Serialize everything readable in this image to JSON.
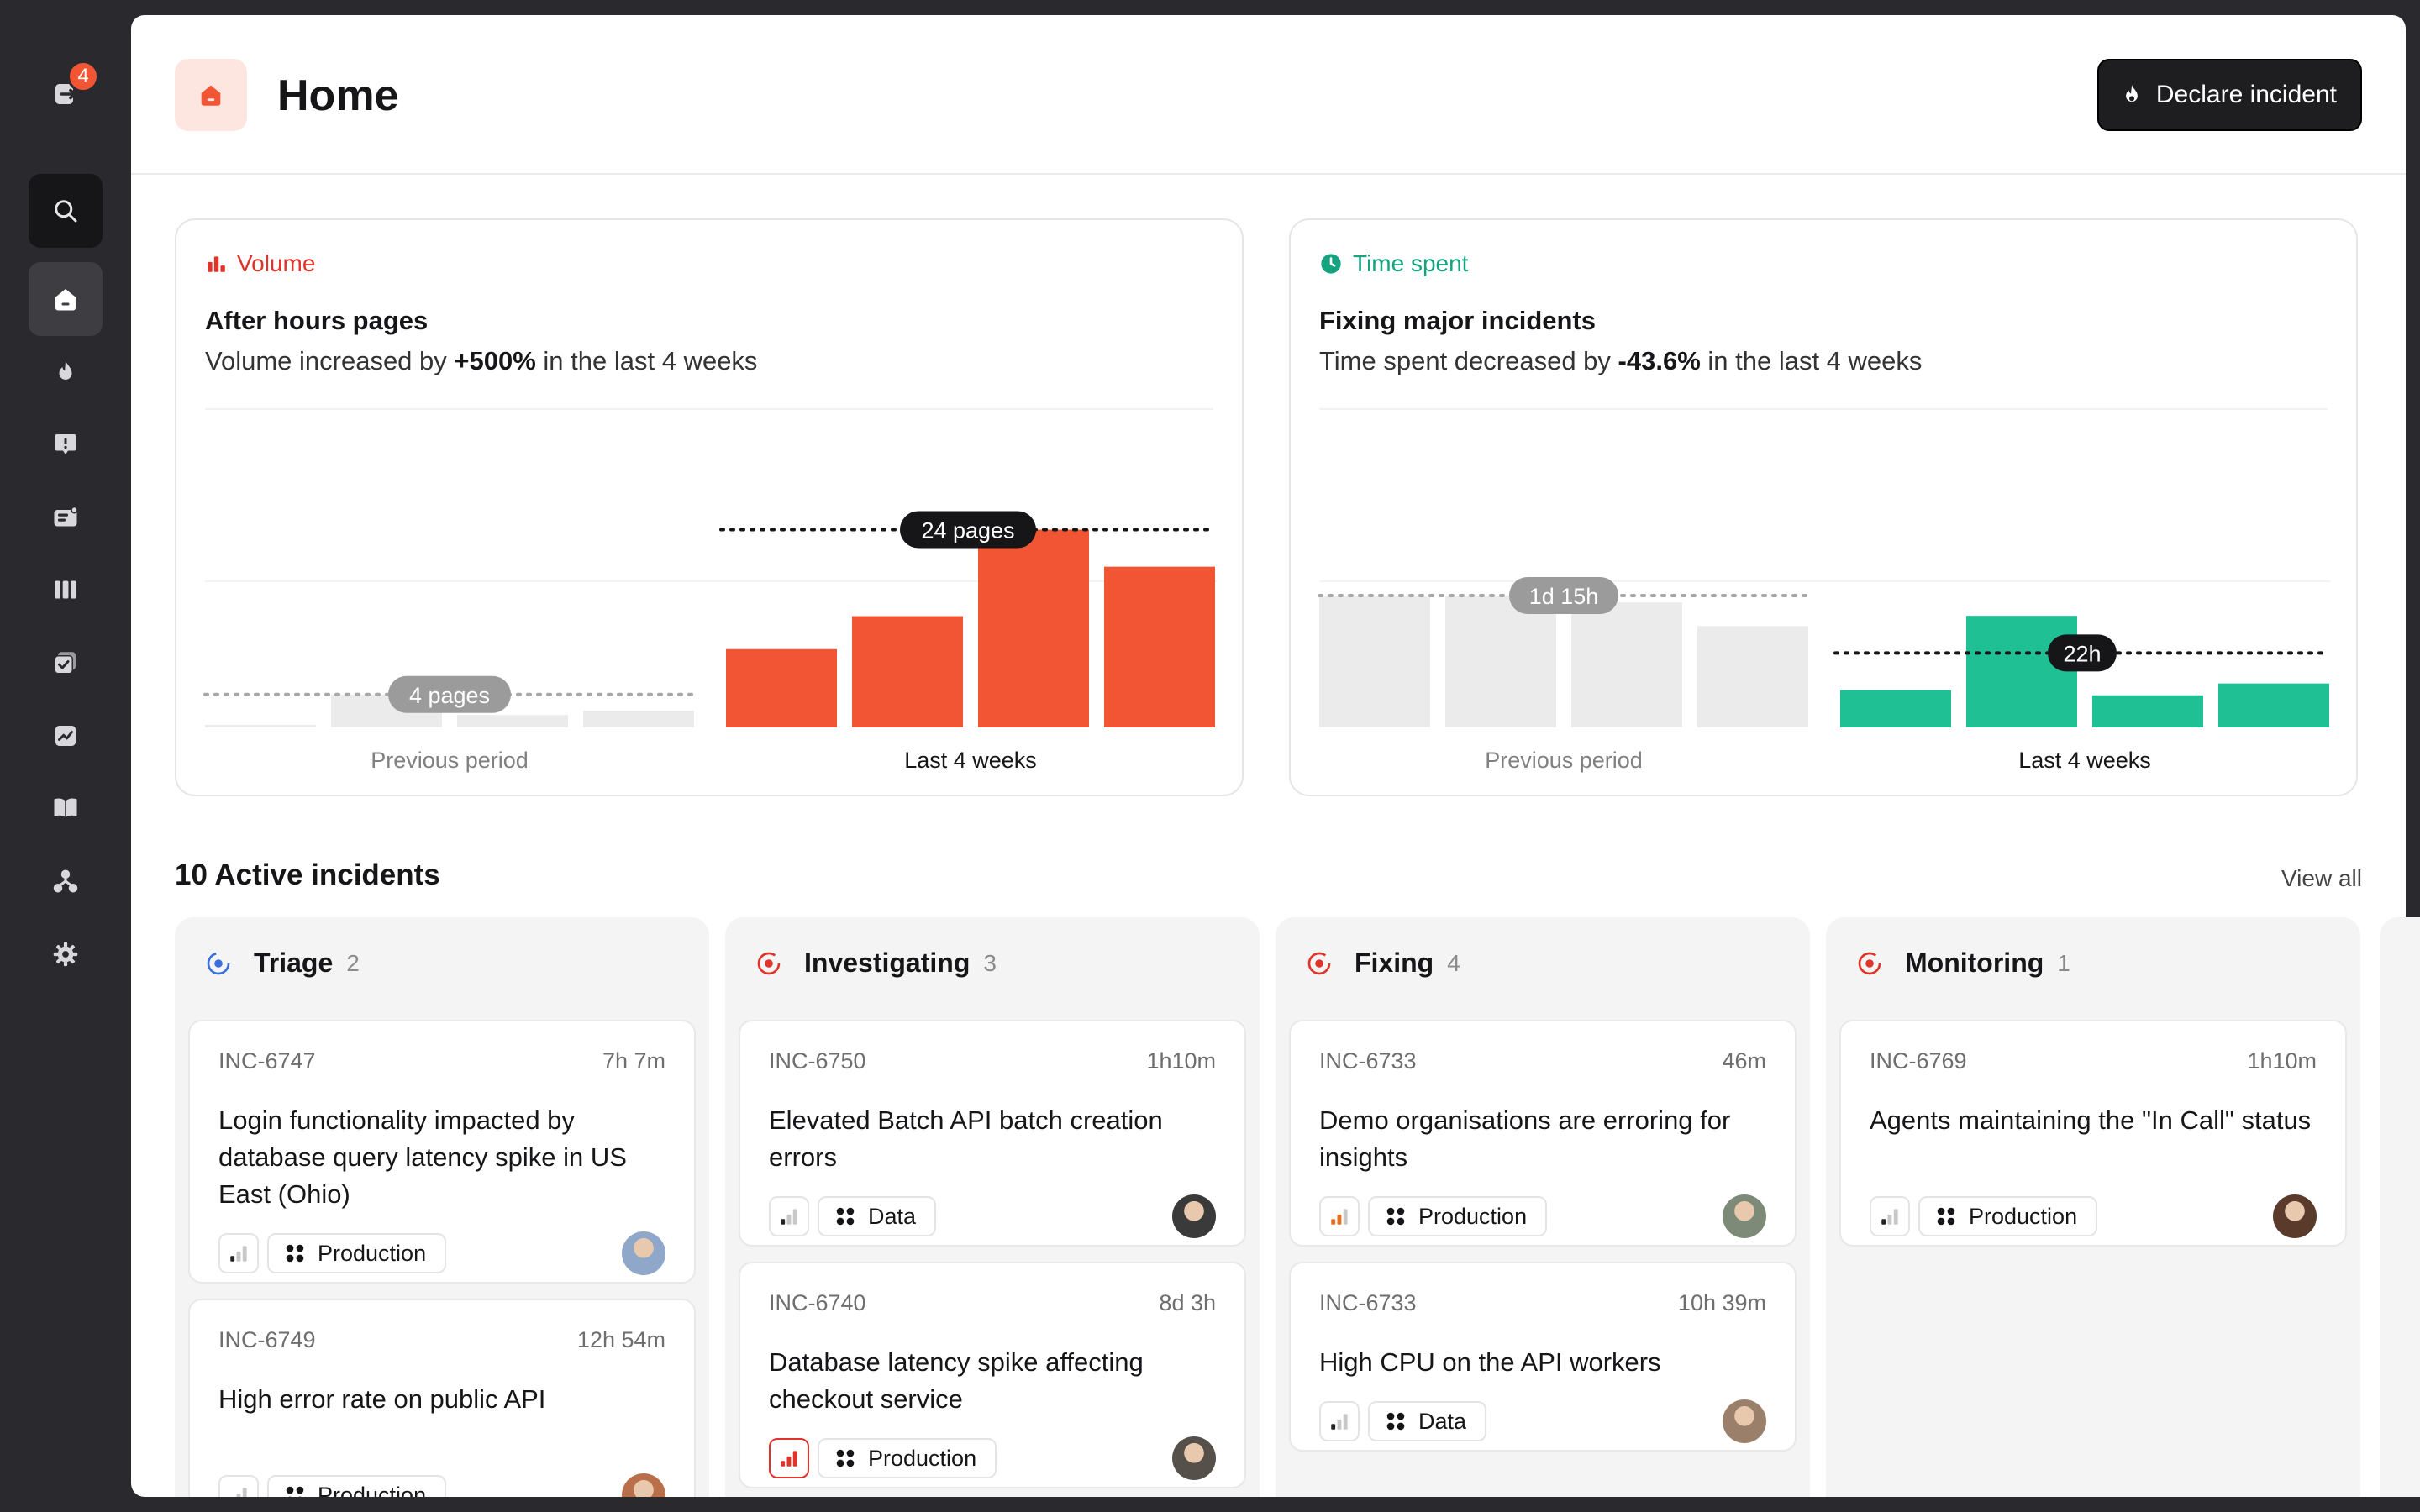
{
  "sidebar": {
    "notification_count": "4",
    "items": [
      {
        "name": "search",
        "icon": "search-icon"
      },
      {
        "name": "home",
        "icon": "home-icon",
        "active": true
      },
      {
        "name": "incidents",
        "icon": "flame-icon"
      },
      {
        "name": "alerts",
        "icon": "alert-icon"
      },
      {
        "name": "on-call",
        "icon": "pager-icon"
      },
      {
        "name": "status-pages",
        "icon": "columns-icon"
      },
      {
        "name": "follow-ups",
        "icon": "checklist-icon"
      },
      {
        "name": "insights",
        "icon": "chart-icon"
      },
      {
        "name": "workflows",
        "icon": "book-icon"
      },
      {
        "name": "catalog",
        "icon": "org-icon"
      },
      {
        "name": "settings",
        "icon": "gear-icon"
      }
    ]
  },
  "header": {
    "title": "Home",
    "declare_label": "Declare incident"
  },
  "volume_card": {
    "tag": "Volume",
    "title": "After hours pages",
    "sub_prefix": "Volume increased by ",
    "sub_value": "+500%",
    "sub_suffix": " in the last 4 weeks",
    "accent": "#f25533"
  },
  "time_card": {
    "tag": "Time spent",
    "title": "Fixing major incidents",
    "sub_prefix": "Time spent decreased by ",
    "sub_value": "-43.6%",
    "sub_suffix": " in the last 4 weeks",
    "accent": "#20c095"
  },
  "chart_data": [
    {
      "type": "bar",
      "title": "After hours pages",
      "group_labels": [
        "Previous period",
        "Last 4 weeks"
      ],
      "previous_period": [
        0.3,
        4,
        1.5,
        2
      ],
      "last_4_weeks": [
        9.5,
        13.5,
        24,
        19.5
      ],
      "previous_avg": 4,
      "previous_avg_label": "4 pages",
      "current_avg": 24,
      "current_avg_label": "24 pages",
      "ylim": [
        0,
        32
      ]
    },
    {
      "type": "bar",
      "title": "Fixing major incidents",
      "group_labels": [
        "Previous period",
        "Last 4 weeks"
      ],
      "previous_period": [
        39,
        39,
        37,
        30
      ],
      "last_4_weeks": [
        11,
        33,
        9.5,
        13
      ],
      "previous_avg": 39,
      "previous_avg_label": "1d 15h",
      "current_avg": 22,
      "current_avg_label": "22h",
      "ylim": [
        0,
        78
      ]
    }
  ],
  "active": {
    "title": "10 Active incidents",
    "view_all": "View all"
  },
  "columns": [
    {
      "name": "Triage",
      "count": "2",
      "status_color": "#3b6fe0",
      "incidents": [
        {
          "id": "INC-6747",
          "time": "7h 7m",
          "title": "Login functionality impacted by database query latency spike in US East (Ohio)",
          "tag": "Production",
          "severity": "low",
          "avatar": "#8fa7c8"
        },
        {
          "id": "INC-6749",
          "time": "12h 54m",
          "title": "High error rate on public API",
          "tag": "Production",
          "severity": "low",
          "avatar": "#b9704a"
        }
      ]
    },
    {
      "name": "Investigating",
      "count": "3",
      "status_color": "#e0342b",
      "incidents": [
        {
          "id": "INC-6750",
          "time": "1h10m",
          "title": "Elevated Batch API batch creation errors",
          "tag": "Data",
          "severity": "low",
          "avatar": "#3a3a3a"
        },
        {
          "id": "INC-6740",
          "time": "8d 3h",
          "title": "Database latency spike affecting checkout service",
          "tag": "Production",
          "severity": "critical",
          "avatar": "#55504a"
        }
      ]
    },
    {
      "name": "Fixing",
      "count": "4",
      "status_color": "#e0342b",
      "incidents": [
        {
          "id": "INC-6733",
          "time": "46m",
          "title": "Demo organisations are erroring for insights",
          "tag": "Production",
          "severity": "medium",
          "avatar": "#7d8a78"
        },
        {
          "id": "INC-6733",
          "time": "10h 39m",
          "title": "High CPU on the API workers",
          "tag": "Data",
          "severity": "low",
          "avatar": "#9a7f6a"
        }
      ]
    },
    {
      "name": "Monitoring",
      "count": "1",
      "status_color": "#e0342b",
      "incidents": [
        {
          "id": "INC-6769",
          "time": "1h10m",
          "title": "Agents maintaining the \"In Call\" status",
          "tag": "Production",
          "severity": "low",
          "avatar": "#5a3a2a"
        }
      ]
    }
  ]
}
